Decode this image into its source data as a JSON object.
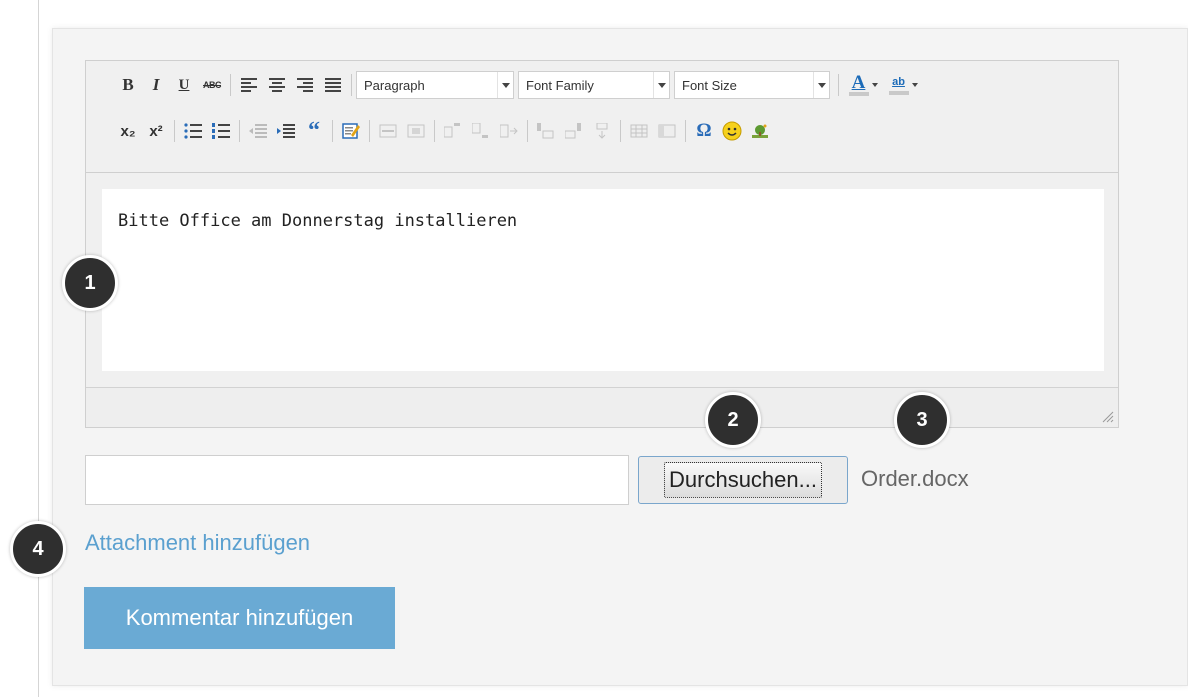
{
  "toolbar": {
    "row1": [
      "B",
      "I",
      "U",
      "ABC"
    ],
    "paragraph": "Paragraph",
    "font_family": "Font Family",
    "font_size": "Font Size",
    "text_color_glyph": "A",
    "highlight_glyph": "ab",
    "blockquote_glyph": "“",
    "special_char_glyph": "Ω",
    "smiley_glyph": "☺",
    "subscript_glyph": "x₂",
    "superscript_glyph": "x²"
  },
  "editor": {
    "content": "Bitte Office am Donnerstag installieren"
  },
  "file": {
    "browse_label": "Durchsuchen...",
    "file_name": "Order.docx"
  },
  "attach_link": "Attachment hinzufügen",
  "submit_label": "Kommentar hinzufügen",
  "callouts": [
    "1",
    "2",
    "3",
    "4"
  ],
  "colors": {
    "accent": "#6aaad4",
    "link": "#5ba0cf",
    "callout": "#2f2f2f",
    "text_color_bar": "#1c6bb8",
    "highlight_bar": "#c9c9c9"
  }
}
